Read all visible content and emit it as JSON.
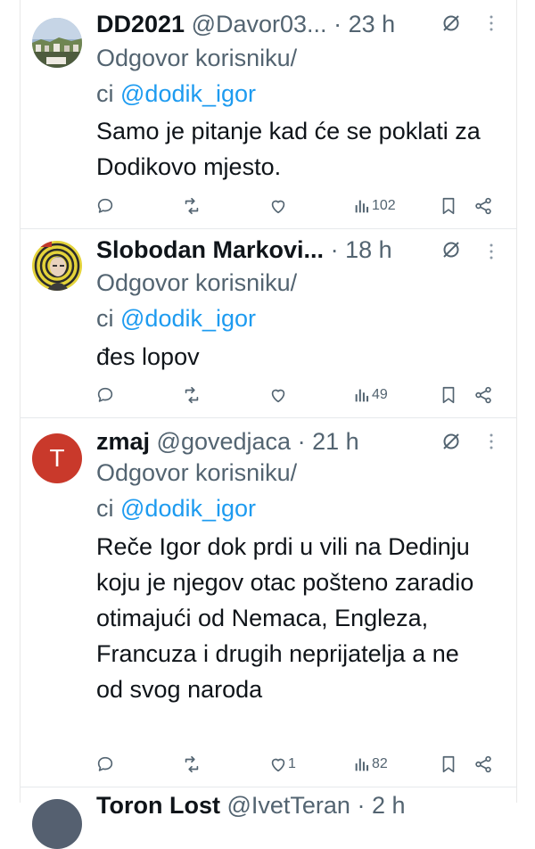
{
  "tweets": [
    {
      "name": "DD2021",
      "handle": "@Davor03...",
      "dot": "·",
      "time": "23 h",
      "reply_prefix": "Odgovor korisniku/",
      "reply_prefix2": "ci",
      "mention": "@dodik_igor",
      "text": "Samo je pitanje kad će se poklati za Dodikovo mjesto.",
      "views": "102",
      "likes": ""
    },
    {
      "name": "Slobodan Markovi...",
      "handle": "",
      "dot": "·",
      "time": "18 h",
      "reply_prefix": "Odgovor korisniku/",
      "reply_prefix2": "ci",
      "mention": "@dodik_igor",
      "text": "đes lopov",
      "views": "49",
      "likes": ""
    },
    {
      "name": "zmaj",
      "handle": "@govedjaca",
      "dot": "·",
      "time": "21 h",
      "avatar_letter": "T",
      "reply_prefix": "Odgovor korisniku/",
      "reply_prefix2": "ci",
      "mention": "@dodik_igor",
      "text": "Reče Igor dok prdi u vili na Dedinju koju je njegov otac pošteno zaradio otimajući od Nemaca, Engleza, Francuza i drugih neprijatelja a ne od svog naroda",
      "views": "82",
      "likes": "1"
    },
    {
      "name": "Toron Lost",
      "handle": "@IvetTeran",
      "dot": "·",
      "time": "2 h"
    }
  ],
  "icons": {
    "reply": "reply-icon",
    "retweet": "retweet-icon",
    "like": "like-icon",
    "views": "views-icon",
    "bookmark": "bookmark-icon",
    "share": "share-icon",
    "grok": "grok-icon",
    "more": "more-icon"
  },
  "colors": {
    "mention": "#1d9bf0",
    "secondary": "#536471",
    "avatar_t": "#c9392b"
  }
}
